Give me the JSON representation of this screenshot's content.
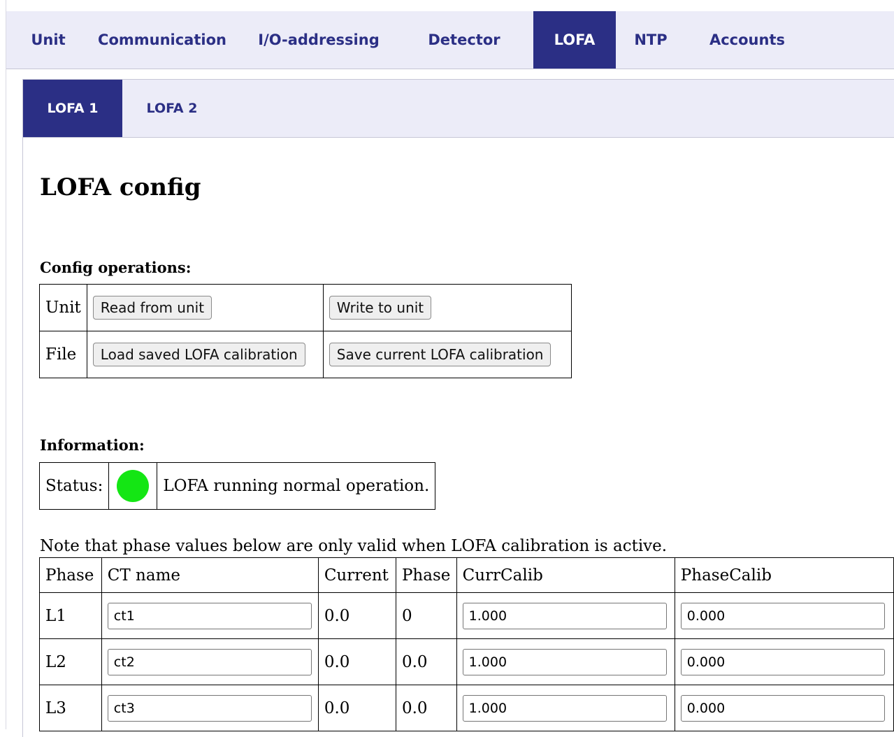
{
  "top_tabs": {
    "unit": "Unit",
    "communication": "Communication",
    "io_addressing": "I/O-addressing",
    "detector": "Detector",
    "lofa": "LOFA",
    "ntp": "NTP",
    "accounts": "Accounts",
    "active": "LOFA"
  },
  "sub_tabs": {
    "lofa1": "LOFA 1",
    "lofa2": "LOFA 2",
    "active": "LOFA 1"
  },
  "page_title": "LOFA config",
  "config_operations": {
    "label": "Config operations:",
    "rows": {
      "unit": {
        "label": "Unit",
        "read": "Read from unit",
        "write": "Write to unit"
      },
      "file": {
        "label": "File",
        "load": "Load saved LOFA calibration",
        "save": "Save current LOFA calibration"
      }
    }
  },
  "information": {
    "label": "Information:",
    "status_label": "Status:",
    "status_color": "#14e614",
    "status_text": "LOFA running normal operation."
  },
  "note": "Note that phase values below are only valid when LOFA calibration is active.",
  "phase_table": {
    "headers": {
      "phase": "Phase",
      "ct_name": "CT name",
      "current": "Current",
      "phase_val": "Phase",
      "curr_calib": "CurrCalib",
      "phase_calib": "PhaseCalib"
    },
    "rows": [
      {
        "phase": "L1",
        "ct_name": "ct1",
        "current": "0.0",
        "phase_val": "0",
        "curr_calib": "1.000",
        "phase_calib": "0.000"
      },
      {
        "phase": "L2",
        "ct_name": "ct2",
        "current": "0.0",
        "phase_val": "0.0",
        "curr_calib": "1.000",
        "phase_calib": "0.000"
      },
      {
        "phase": "L3",
        "ct_name": "ct3",
        "current": "0.0",
        "phase_val": "0.0",
        "curr_calib": "1.000",
        "phase_calib": "0.000"
      }
    ]
  },
  "colors": {
    "nav_bg": "#ececf8",
    "nav_active_bg": "#2b2f85",
    "nav_text": "#2b2f85"
  }
}
